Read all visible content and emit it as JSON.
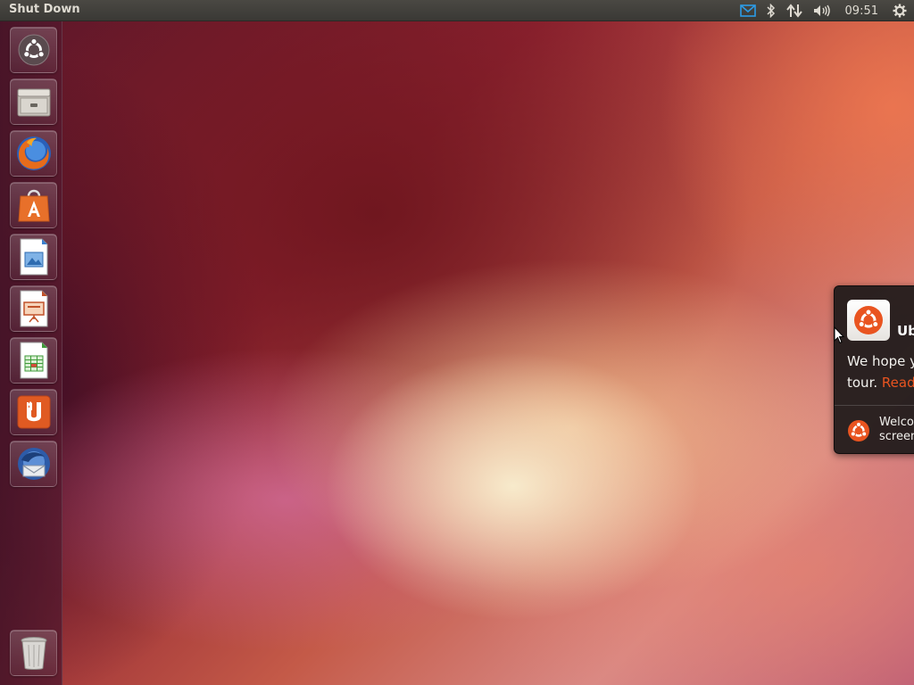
{
  "top_panel": {
    "app_title": "Shut Down",
    "indicators": [
      {
        "name": "mail-indicator",
        "icon": "envelope-icon"
      },
      {
        "name": "bluetooth-indicator",
        "icon": "bluetooth-icon"
      },
      {
        "name": "network-indicator",
        "icon": "network-arrows-icon"
      },
      {
        "name": "sound-indicator",
        "icon": "speaker-icon"
      }
    ],
    "clock": "09:51",
    "session_icon": "gear-icon"
  },
  "launcher": {
    "items": [
      {
        "name": "dash-home",
        "icon": "ubuntu-logo-icon"
      },
      {
        "name": "files",
        "icon": "file-cabinet-icon"
      },
      {
        "name": "firefox",
        "icon": "firefox-icon"
      },
      {
        "name": "software-center",
        "icon": "shopping-bag-icon"
      },
      {
        "name": "libreoffice-writer",
        "icon": "writer-document-icon"
      },
      {
        "name": "libreoffice-impress",
        "icon": "impress-presentation-icon"
      },
      {
        "name": "libreoffice-calc",
        "icon": "calc-spreadsheet-icon"
      },
      {
        "name": "ubuntu-one",
        "icon": "ubuntu-one-icon"
      },
      {
        "name": "thunderbird",
        "icon": "thunderbird-icon"
      }
    ],
    "trash": {
      "name": "trash",
      "icon": "trash-can-icon"
    }
  },
  "notification": {
    "title": "Ub",
    "body_line1": "We hope y",
    "body_line2_prefix": "tour. ",
    "body_link": "Read",
    "footer_line1": "Welco",
    "footer_line2": "screen"
  },
  "colors": {
    "ubuntu_orange": "#e95420",
    "panel_bg": "#3c3b37",
    "launcher_bg": "#4a1a2c"
  }
}
